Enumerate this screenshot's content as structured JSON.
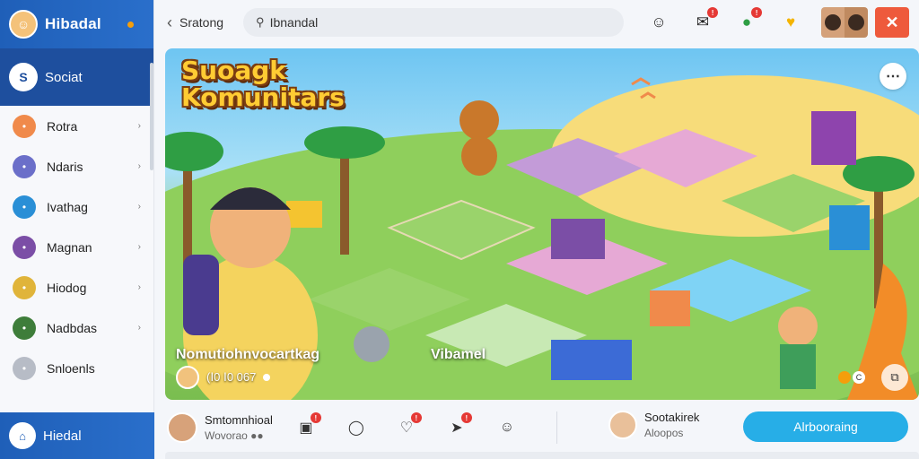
{
  "sidebar": {
    "header_title": "Hibadal",
    "active_item": "Sociat",
    "items": [
      {
        "label": "Rotra",
        "icon": "flame-icon",
        "color": "#f08a4b"
      },
      {
        "label": "Ndaris",
        "icon": "link-icon",
        "color": "#6b6fc9"
      },
      {
        "label": "Ivathag",
        "icon": "tag-icon",
        "color": "#2a8fd6"
      },
      {
        "label": "Magnan",
        "icon": "user-icon",
        "color": "#7b4ea6"
      },
      {
        "label": "Hiodog",
        "icon": "face-icon",
        "color": "#e0b43a"
      },
      {
        "label": "Nadbdas",
        "icon": "person-icon",
        "color": "#3e7d3a"
      },
      {
        "label": "Snloenls",
        "icon": "avatar-icon",
        "color": "#b7bcc6"
      }
    ],
    "footer_label": "Hiedal"
  },
  "topbar": {
    "back_label": "Sratong",
    "search_value": "Ibnandal"
  },
  "hero": {
    "title_line1": "Suoagk",
    "title_line2": "Komunitars",
    "caption_left": "Nomutiohnvocartkag",
    "caption_mid": "Vibamel",
    "meta_text": "(Ⅰ0 Ⅰ0 067",
    "ctrl_label": "C"
  },
  "bottombar": {
    "author_name": "Smtomnhioal",
    "author_sub": "Wovorao",
    "author2_name": "Sootakirek",
    "author2_sub": "Aloopos",
    "follow_label": "Alrbooraing"
  },
  "colors": {
    "brand_blue": "#1f5fb8",
    "accent_cyan": "#27aee7",
    "badge_red": "#e53935",
    "close_orange": "#ee5a3c"
  }
}
